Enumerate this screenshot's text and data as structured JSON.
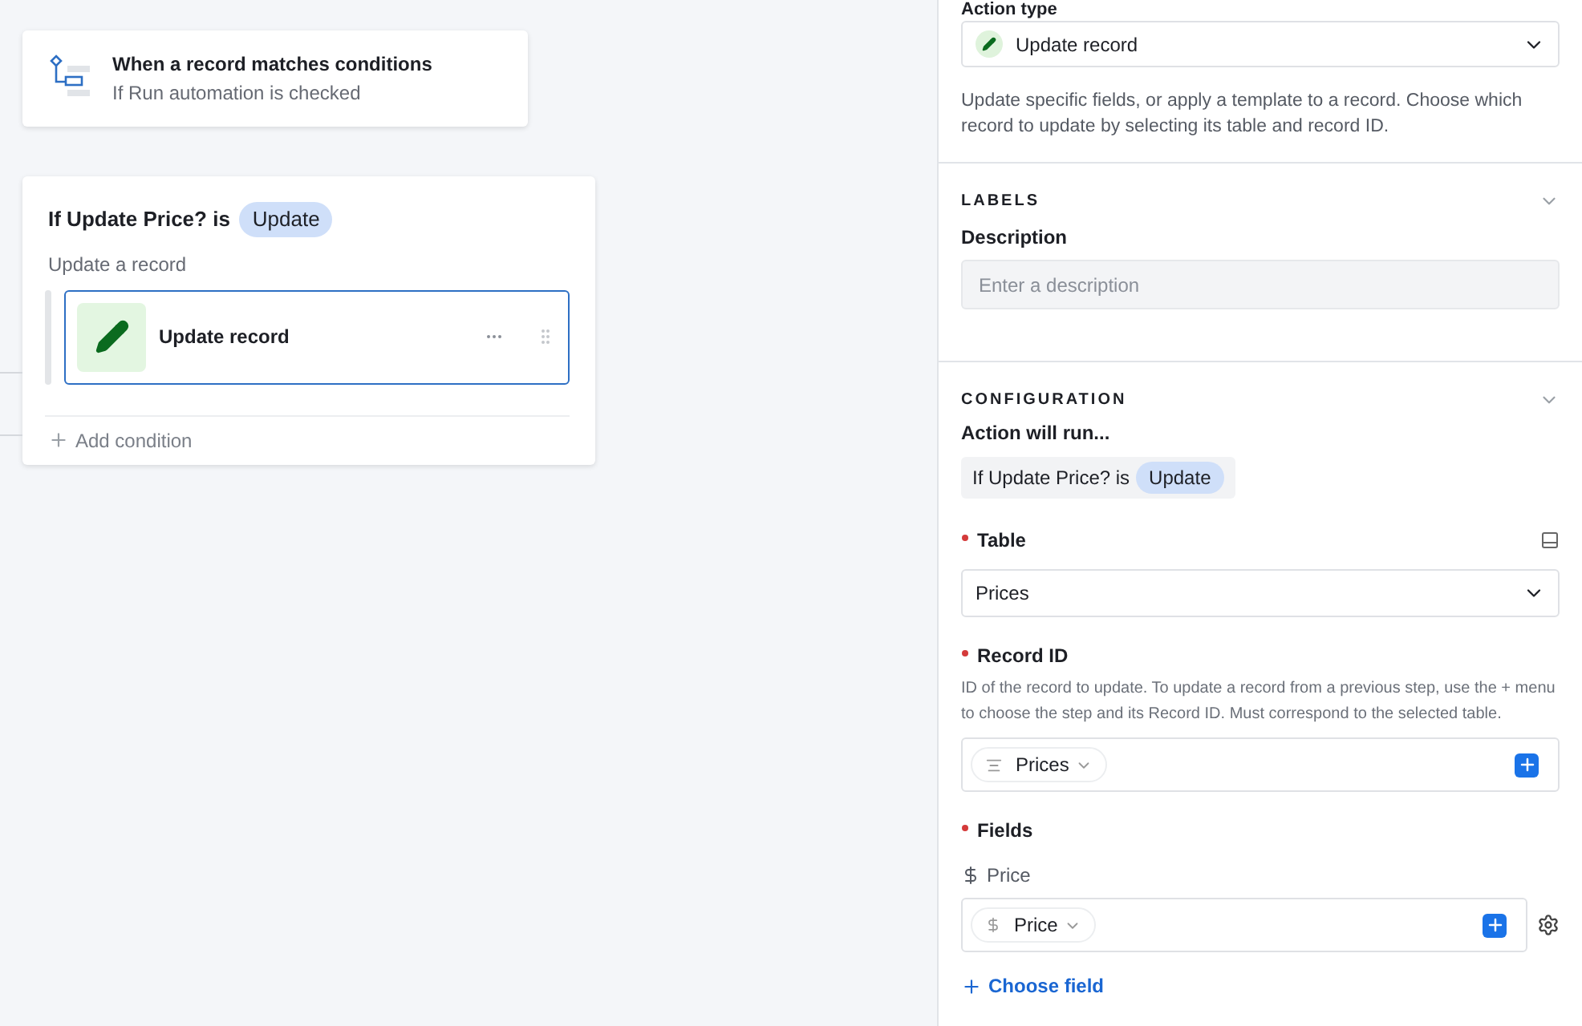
{
  "trigger": {
    "title": "When a record matches conditions",
    "subtitle": "If Run automation is checked"
  },
  "condition_card": {
    "prefix": "If Update Price? is",
    "value": "Update",
    "group_label": "Update a record",
    "action": {
      "label": "Update record",
      "selected": true
    },
    "add_condition": "Add condition"
  },
  "panel": {
    "action_type": {
      "label": "Action type",
      "value": "Update record"
    },
    "description_text": "Update specific fields, or apply a template to a record. Choose which record to update by selecting its table and record ID.",
    "labels_section": {
      "heading": "LABELS",
      "expanded": true,
      "description_label": "Description",
      "description_placeholder": "Enter a description"
    },
    "configuration_section": {
      "heading": "CONFIGURATION",
      "expanded": true,
      "runs_label": "Action will run...",
      "condition_prefix": "If Update Price? is",
      "condition_value": "Update",
      "table": {
        "label": "Table",
        "required": true,
        "value": "Prices"
      },
      "record_id": {
        "label": "Record ID",
        "required": true,
        "help": "ID of the record to update. To update a record from a previous step, use the + menu to choose the step and its Record ID. Must correspond to the selected table.",
        "token": "Prices"
      },
      "fields": {
        "label": "Fields",
        "required": true,
        "items": [
          {
            "name": "Price",
            "token": "Price"
          }
        ]
      },
      "choose_field": "Choose field"
    }
  }
}
